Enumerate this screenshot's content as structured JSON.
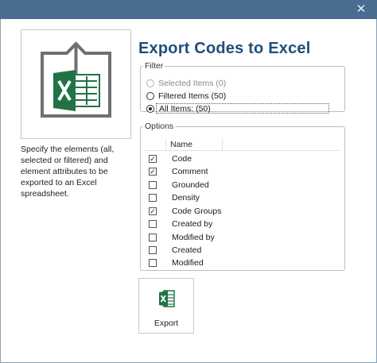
{
  "window": {
    "close_glyph": "✕"
  },
  "title": "Export Codes to Excel",
  "description": "Specify the elements (all, selected or filtered) and element attributes to be exported to an Excel spreadsheet.",
  "filter": {
    "legend": "Filter",
    "options": [
      {
        "label": "Selected Items (0)",
        "state": "disabled"
      },
      {
        "label": "Filtered Items (50)",
        "state": "enabled"
      },
      {
        "label": "All Items: (50)",
        "state": "selected"
      }
    ]
  },
  "options": {
    "legend": "Options",
    "column_header": "Name",
    "items": [
      {
        "label": "Code",
        "checked": true
      },
      {
        "label": "Comment",
        "checked": true
      },
      {
        "label": "Grounded",
        "checked": false
      },
      {
        "label": "Density",
        "checked": false
      },
      {
        "label": "Code Groups",
        "checked": true
      },
      {
        "label": "Created by",
        "checked": false
      },
      {
        "label": "Modified by",
        "checked": false
      },
      {
        "label": "Created",
        "checked": false
      },
      {
        "label": "Modified",
        "checked": false
      }
    ]
  },
  "export_button": {
    "label": "Export",
    "icon": "excel-icon"
  },
  "colors": {
    "title": "#1f4e79",
    "titlebar": "#4a6e92",
    "excel_green": "#217346",
    "arrow_gray": "#707070"
  }
}
